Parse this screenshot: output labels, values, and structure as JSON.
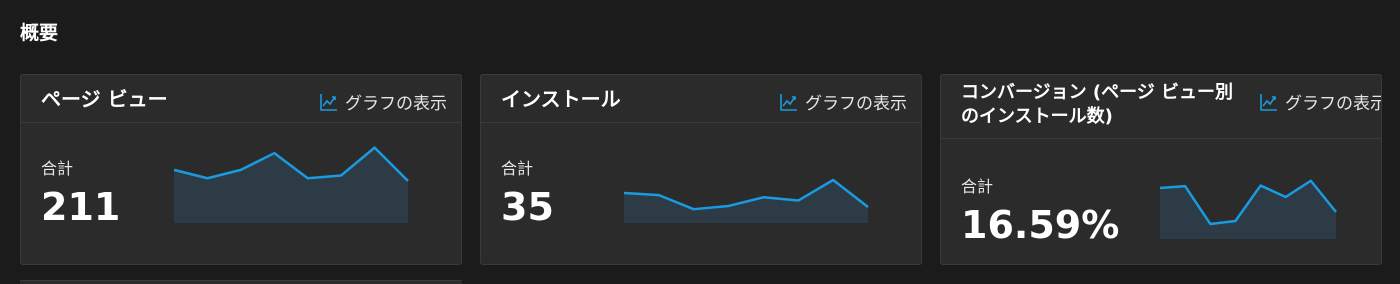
{
  "overview": {
    "title": "概要"
  },
  "graph_link_label": "グラフの表示",
  "graph_icon": "line-chart-icon",
  "colors": {
    "accent": "#1a9be0",
    "fill": "#2c3b45",
    "background": "#1b1b1b",
    "card": "#2b2b2b"
  },
  "cards": [
    {
      "title": "ページ ビュー",
      "total_label": "合計",
      "total_value": "211",
      "spark_values": [
        9,
        7.5,
        9,
        12,
        7.5,
        8,
        13,
        7
      ]
    },
    {
      "title": "インストール",
      "total_label": "合計",
      "total_value": "35",
      "spark_values": [
        5,
        4.6,
        2,
        2.6,
        4.2,
        3.6,
        7.4,
        2.4
      ]
    },
    {
      "title": "コンバージョン (ページ ビュー別のインストール数)",
      "total_label": "合計",
      "total_value": "16.59%",
      "spark_values": [
        8,
        8.3,
        2,
        2.5,
        8.4,
        6.5,
        9.2,
        4
      ]
    }
  ]
}
